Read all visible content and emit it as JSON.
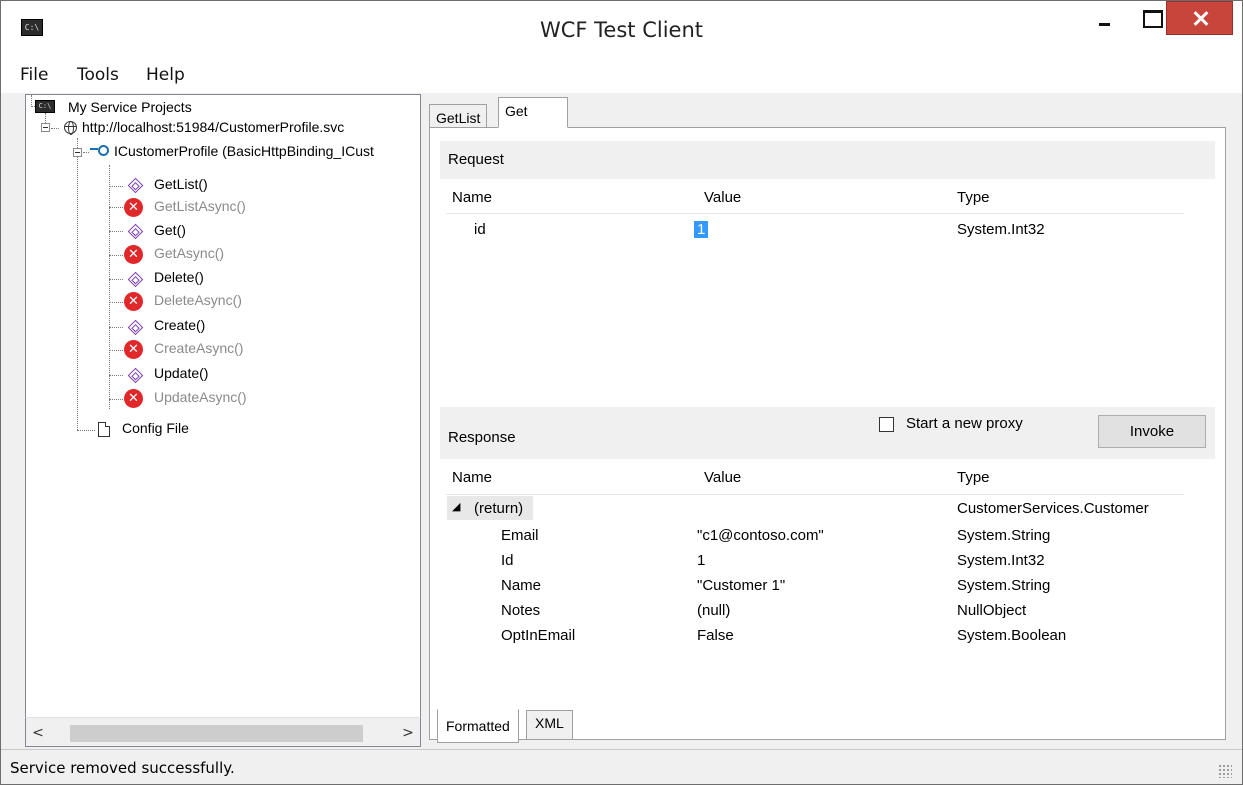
{
  "window": {
    "title": "WCF Test Client",
    "icon_text": "C:\\"
  },
  "menu": {
    "items": [
      "File",
      "Tools",
      "Help"
    ]
  },
  "tree": {
    "root": "My Service Projects",
    "service": "http://localhost:51984/CustomerProfile.svc",
    "interface": "ICustomerProfile (BasicHttpBinding_ICust",
    "operations": [
      {
        "label": "GetList()",
        "disabled": false
      },
      {
        "label": "GetListAsync()",
        "disabled": true
      },
      {
        "label": "Get()",
        "disabled": false
      },
      {
        "label": "GetAsync()",
        "disabled": true
      },
      {
        "label": "Delete()",
        "disabled": false
      },
      {
        "label": "DeleteAsync()",
        "disabled": true
      },
      {
        "label": "Create()",
        "disabled": false
      },
      {
        "label": "CreateAsync()",
        "disabled": true
      },
      {
        "label": "Update()",
        "disabled": false
      },
      {
        "label": "UpdateAsync()",
        "disabled": true
      }
    ],
    "config": "Config File"
  },
  "tabs": {
    "items": [
      "GetList",
      "Get"
    ],
    "active": "Get"
  },
  "request": {
    "header": "Request",
    "columns": [
      "Name",
      "Value",
      "Type"
    ],
    "rows": [
      {
        "name": "id",
        "value": "1",
        "type": "System.Int32"
      }
    ]
  },
  "proxy": {
    "checkbox_label": "Start a new proxy",
    "checked": false
  },
  "invoke_label": "Invoke",
  "response": {
    "header": "Response",
    "columns": [
      "Name",
      "Value",
      "Type"
    ],
    "root": {
      "name": "(return)",
      "value": "",
      "type": "CustomerServices.Customer"
    },
    "rows": [
      {
        "name": "Email",
        "value": "\"c1@contoso.com\"",
        "type": "System.String"
      },
      {
        "name": "Id",
        "value": "1",
        "type": "System.Int32"
      },
      {
        "name": "Name",
        "value": "\"Customer 1\"",
        "type": "System.String"
      },
      {
        "name": "Notes",
        "value": "(null)",
        "type": "NullObject"
      },
      {
        "name": "OptInEmail",
        "value": "False",
        "type": "System.Boolean"
      }
    ]
  },
  "bottom_tabs": {
    "items": [
      "Formatted",
      "XML"
    ],
    "active": "Formatted"
  },
  "status": {
    "text": "Service removed successfully."
  },
  "icons": {
    "error_glyph": "✕",
    "scroll_left": "<",
    "scroll_right": ">",
    "collapse_arrow": "◢"
  }
}
